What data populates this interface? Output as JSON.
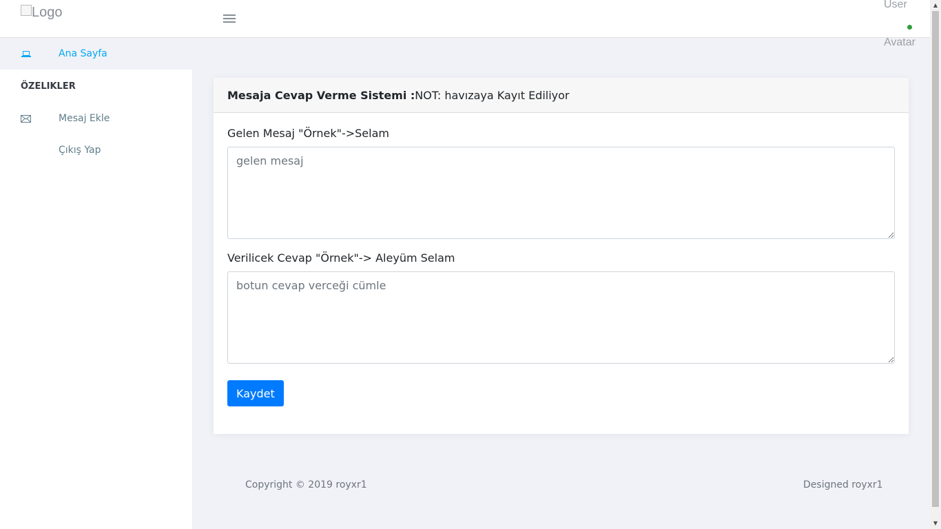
{
  "header": {
    "logo_alt": "Logo",
    "user_label": "User",
    "avatar_label": "Avatar"
  },
  "sidebar": {
    "home_label": "Ana Sayfa",
    "section_heading": "ÖZELIKLER",
    "items": [
      {
        "label": "Mesaj Ekle",
        "icon": "mail-icon"
      },
      {
        "label": "Çıkış Yap",
        "icon": ""
      }
    ]
  },
  "card": {
    "title_bold": "Mesaja Cevap Verme Sistemi :",
    "title_note": "NOT: havızaya Kayıt Ediliyor",
    "fields": [
      {
        "label": "Gelen Mesaj \"Örnek\"->Selam",
        "placeholder": "gelen mesaj",
        "value": ""
      },
      {
        "label": "Verilicek Cevap \"Örnek\"-> Aleyüm Selam",
        "placeholder": "botun cevap verceği cümle",
        "value": ""
      }
    ],
    "save_label": "Kaydet"
  },
  "footer": {
    "copyright": "Copyright © 2019 royxr1",
    "designed": "Designed royxr1"
  },
  "colors": {
    "accent": "#03a9f3",
    "primary_button": "#007bff",
    "status_online": "#2e9e3d"
  }
}
